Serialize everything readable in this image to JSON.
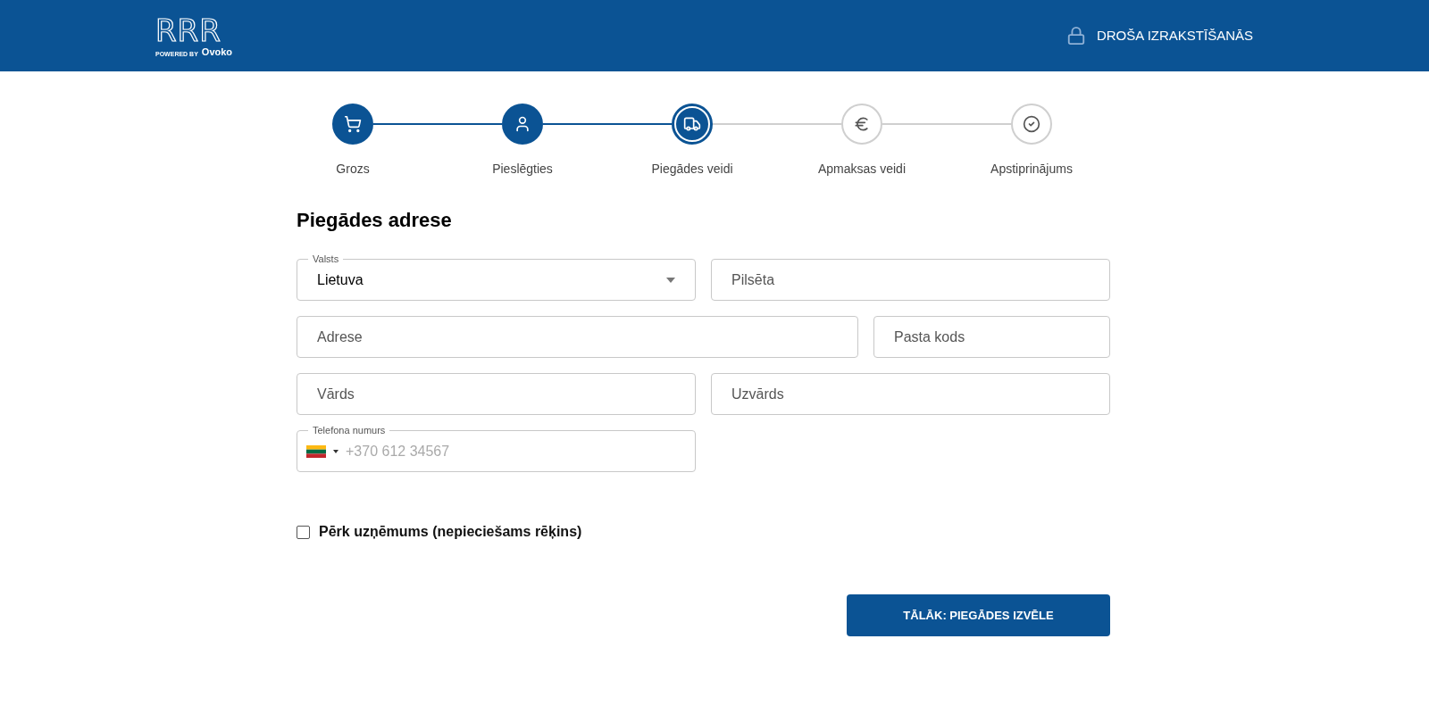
{
  "header": {
    "logo": {
      "mark": "RRR",
      "tagline": "POWERED BY",
      "brand": "Ovoko"
    },
    "secure_label": "DROŠA IZRAKSTĪŠANĀS"
  },
  "steps": [
    {
      "label": "Grozs",
      "kind": "done"
    },
    {
      "label": "Pieslēgties",
      "kind": "done"
    },
    {
      "label": "Piegādes veidi",
      "kind": "current"
    },
    {
      "label": "Apmaksas veidi",
      "kind": "pending"
    },
    {
      "label": "Apstiprinājums",
      "kind": "pending"
    }
  ],
  "form": {
    "title": "Piegādes adrese",
    "country": {
      "label": "Valsts",
      "value": "Lietuva"
    },
    "city": {
      "placeholder": "Pilsēta"
    },
    "address": {
      "placeholder": "Adrese"
    },
    "postal_code": {
      "placeholder": "Pasta kods"
    },
    "first_name": {
      "placeholder": "Vārds"
    },
    "last_name": {
      "placeholder": "Uzvārds"
    },
    "phone": {
      "label": "Telefona numurs",
      "placeholder": "+370 612 34567"
    },
    "company_checkbox": {
      "label": "Pērk uzņēmums (nepieciešams rēķins)",
      "checked": false
    },
    "next_button": "TĀLĀK: PIEGĀDES IZVĒLE"
  }
}
